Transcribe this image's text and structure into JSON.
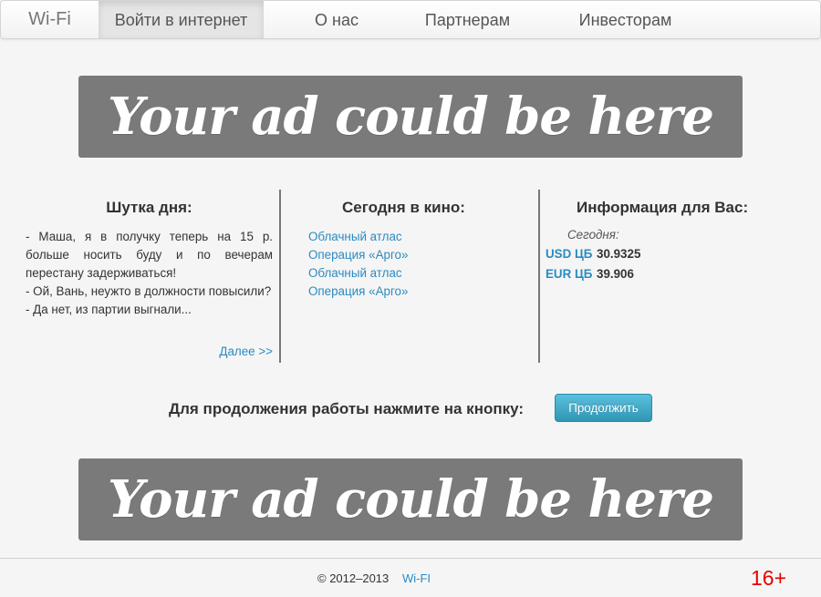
{
  "nav": {
    "brand": "Wi-Fi",
    "items": [
      {
        "label": "Войти в интернет",
        "active": true
      },
      {
        "label": "О нас",
        "active": false
      },
      {
        "label": "Партнерам",
        "active": false
      },
      {
        "label": "Инвесторам",
        "active": false
      }
    ]
  },
  "ads": {
    "top_text": "Your ad could be here",
    "bottom_text": "Your ad could be here"
  },
  "joke": {
    "title": "Шутка дня:",
    "lines": [
      "- Маша, я в получку теперь на 15 р. больше носить буду и по вечерам перестану задерживаться!",
      "- Ой, Вань, неужто в должности повысили?",
      "- Да нет, из партии выгнали..."
    ],
    "more_link": "Далее >>"
  },
  "cinema": {
    "title": "Сегодня в кино:",
    "movies": [
      "Облачный атлас",
      "Операция «Арго»",
      "Облачный атлас",
      "Операция «Арго»"
    ]
  },
  "info": {
    "title": "Информация для Вас:",
    "today_label": "Сегодня:",
    "rates": [
      {
        "name": "USD ЦБ",
        "value": "30.9325"
      },
      {
        "name": "EUR ЦБ",
        "value": "39.906"
      }
    ]
  },
  "continue": {
    "prompt": "Для продолжения работы нажмите на кнопку:",
    "button_label": "Продолжить"
  },
  "footer": {
    "copyright": "© 2012–2013",
    "link": "Wi-FI",
    "age_rating": "16+"
  },
  "colors": {
    "link": "#2a8bc2",
    "button": "#2f96b4",
    "age_rating": "#e30000",
    "ad_background": "#7a7a7a"
  }
}
